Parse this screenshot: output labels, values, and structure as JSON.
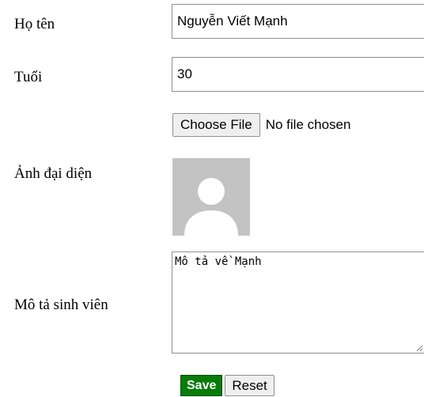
{
  "form": {
    "name": {
      "label": "Họ tên",
      "value": "Nguyễn Viết Mạnh"
    },
    "age": {
      "label": "Tuổi",
      "value": "30"
    },
    "file": {
      "button_label": "Choose File",
      "status": "No file chosen"
    },
    "avatar": {
      "label": "Ảnh đại diện",
      "icon": "default-user-avatar-icon"
    },
    "description": {
      "label": "Mô tả sinh viên",
      "value": "Mô tả về Mạnh"
    },
    "actions": {
      "save_label": "Save",
      "reset_label": "Reset"
    }
  },
  "colors": {
    "save_button_bg": "#087c08",
    "avatar_bg": "#c3c3c3",
    "avatar_figure": "#ffffff",
    "input_border": "#8f8f8f"
  }
}
